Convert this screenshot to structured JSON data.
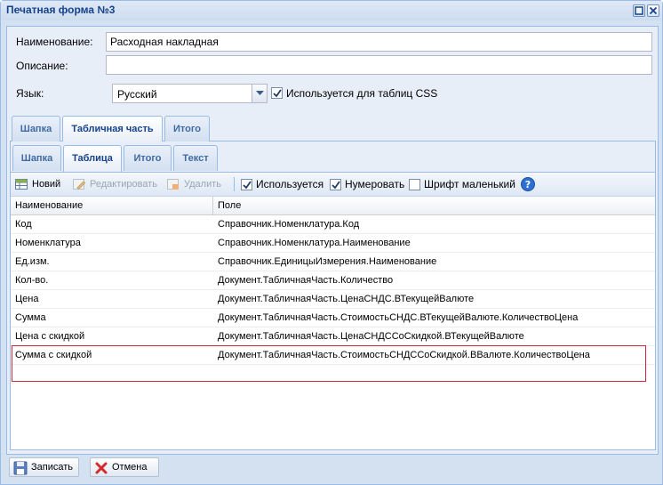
{
  "window": {
    "title": "Печатная форма №3"
  },
  "form": {
    "name_label": "Наименование:",
    "name_value": "Расходная накладная",
    "description_label": "Описание:",
    "description_value": "",
    "language_label": "Язык:",
    "language_value": "Русский",
    "css_checkbox_label": "Используется для таблиц CSS",
    "css_checkbox_checked": true
  },
  "outer_tabs": [
    {
      "label": "Шапка",
      "active": false
    },
    {
      "label": "Табличная часть",
      "active": true
    },
    {
      "label": "Итого",
      "active": false
    }
  ],
  "inner_tabs": [
    {
      "label": "Шапка",
      "active": false
    },
    {
      "label": "Таблица",
      "active": true
    },
    {
      "label": "Итого",
      "active": false
    },
    {
      "label": "Текст",
      "active": false
    }
  ],
  "toolbar": {
    "new_label": "Новий",
    "edit_label": "Редактировать",
    "delete_label": "Удалить",
    "used_label": "Используется",
    "used_checked": true,
    "numbering_label": "Нумеровать",
    "numbering_checked": true,
    "small_font_label": "Шрифт маленький",
    "small_font_checked": false
  },
  "grid": {
    "columns": [
      "Наименование",
      "Поле"
    ],
    "rows": [
      {
        "name": "Код",
        "field": "Справочник.Номенклатура.Код"
      },
      {
        "name": "Номенклатура",
        "field": "Справочник.Номенклатура.Наименование"
      },
      {
        "name": "Ед.изм.",
        "field": "Справочник.ЕдиницыИзмерения.Наименование"
      },
      {
        "name": "Кол-во.",
        "field": "Документ.ТабличнаяЧасть.Количество"
      },
      {
        "name": "Цена",
        "field": "Документ.ТабличнаяЧасть.ЦенаСНДС.ВТекущейВалюте"
      },
      {
        "name": "Сумма",
        "field": "Документ.ТабличнаяЧасть.СтоимостьСНДС.ВТекущейВалюте.КоличествоЦена"
      },
      {
        "name": "Цена с скидкой",
        "field": "Документ.ТабличнаяЧасть.ЦенаСНДССоСкидкой.ВТекущейВалюте"
      },
      {
        "name": "Сумма с скидкой",
        "field": "Документ.ТабличнаяЧасть.СтоимостьСНДССоСкидкой.ВВалюте.КоличествоЦена"
      }
    ]
  },
  "footer": {
    "save_label": "Записать",
    "cancel_label": "Отмена"
  },
  "colors": {
    "title_text": "#15428b",
    "highlight_border": "#d0263d",
    "panel_bg": "#e8eef7"
  }
}
